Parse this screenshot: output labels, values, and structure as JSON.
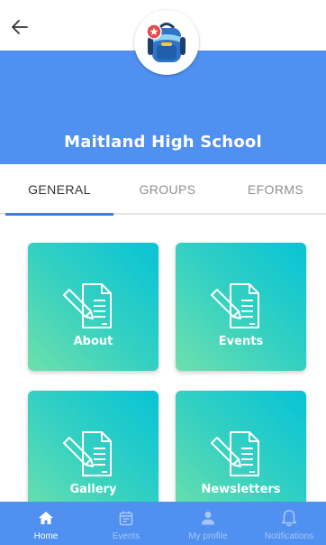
{
  "header": {
    "back_icon": "arrow-left-icon",
    "logo_icon": "backpack-icon",
    "school_name": "Maitland High School",
    "band_color": "#4f90f0"
  },
  "tabs": [
    {
      "label": "GENERAL",
      "active": true
    },
    {
      "label": "GROUPS",
      "active": false
    },
    {
      "label": "EFORMS",
      "active": false
    }
  ],
  "cards": [
    {
      "label": "About",
      "icon": "document-pencil-icon"
    },
    {
      "label": "Events",
      "icon": "document-pencil-icon"
    },
    {
      "label": "Gallery",
      "icon": "document-pencil-icon"
    },
    {
      "label": "Newsletters",
      "icon": "document-pencil-icon"
    }
  ],
  "bottom_nav": [
    {
      "label": "Home",
      "icon": "home-icon",
      "active": true
    },
    {
      "label": "Events",
      "icon": "calendar-icon",
      "active": false
    },
    {
      "label": "My profile",
      "icon": "person-icon",
      "active": false
    },
    {
      "label": "Notifications",
      "icon": "bell-icon",
      "active": false
    }
  ],
  "colors": {
    "primary": "#4f90f0",
    "tab_indicator": "#3d7be0",
    "card_gradient_start": "#07c3d6",
    "card_gradient_end": "#6ee0ac"
  }
}
